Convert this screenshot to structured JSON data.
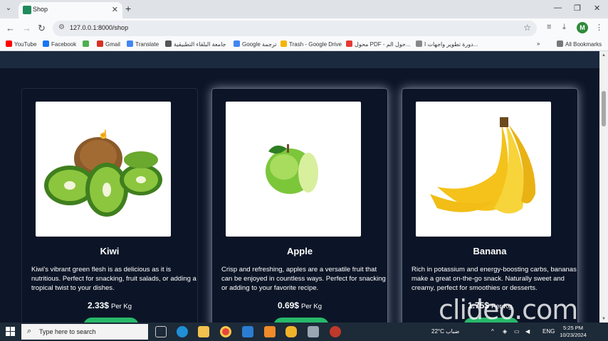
{
  "browser": {
    "tab_title": "Shop",
    "url": "127.0.0.1:8000/shop",
    "profile_initial": "M",
    "bookmarks": [
      {
        "label": "YouTube",
        "icon": "youtube-icon",
        "color": "#ff0000"
      },
      {
        "label": "Facebook",
        "icon": "facebook-icon",
        "color": "#1877f2"
      },
      {
        "label": "",
        "icon": "app-icon",
        "color": "#4caf50"
      },
      {
        "label": "Gmail",
        "icon": "gmail-icon",
        "color": "#d93025"
      },
      {
        "label": "Translate",
        "icon": "translate-icon",
        "color": "#4285f4"
      },
      {
        "label": "جامعة البلقاء التطبيقية",
        "icon": "university-icon",
        "color": "#555555"
      },
      {
        "label": "Google ترجمة",
        "icon": "translate-icon",
        "color": "#4285f4"
      },
      {
        "label": "Trash - Google Drive",
        "icon": "drive-icon",
        "color": "#f4b400"
      },
      {
        "label": "محول PDF - حول الم...",
        "icon": "pdf-icon",
        "color": "#e53935"
      },
      {
        "label": "دورة تطوير واجهات ا...",
        "icon": "course-icon",
        "color": "#888888"
      }
    ],
    "all_bookmarks": "All Bookmarks"
  },
  "products": [
    {
      "name": "Kiwi",
      "description": "Kiwi's vibrant green flesh is as delicious as it is nutritious. Perfect for snacking, fruit salads, or adding a tropical twist to your dishes.",
      "price": "2.33$",
      "unit": "Per Kg"
    },
    {
      "name": "Apple",
      "description": "Crisp and refreshing, apples are a versatile fruit that can be enjoyed in countless ways. Perfect for snacking or adding to your favorite recipe.",
      "price": "0.69$",
      "unit": "Per Kg"
    },
    {
      "name": "Banana",
      "description": "Rich in potassium and energy-boosting carbs, bananas make a great on-the-go snack. Naturally sweet and creamy, perfect for smoothies or desserts.",
      "price": "1.75$",
      "unit": "Per Kg"
    }
  ],
  "watermark": "clideo.com",
  "taskbar": {
    "search_placeholder": "Type here to search",
    "weather": "22°C",
    "weather_text": "ضباب",
    "lang": "ENG",
    "time": "5:25 PM",
    "date": "10/23/2024"
  },
  "colors": {
    "page_bg": "#0d1628",
    "accent_button": "#27b86a"
  }
}
